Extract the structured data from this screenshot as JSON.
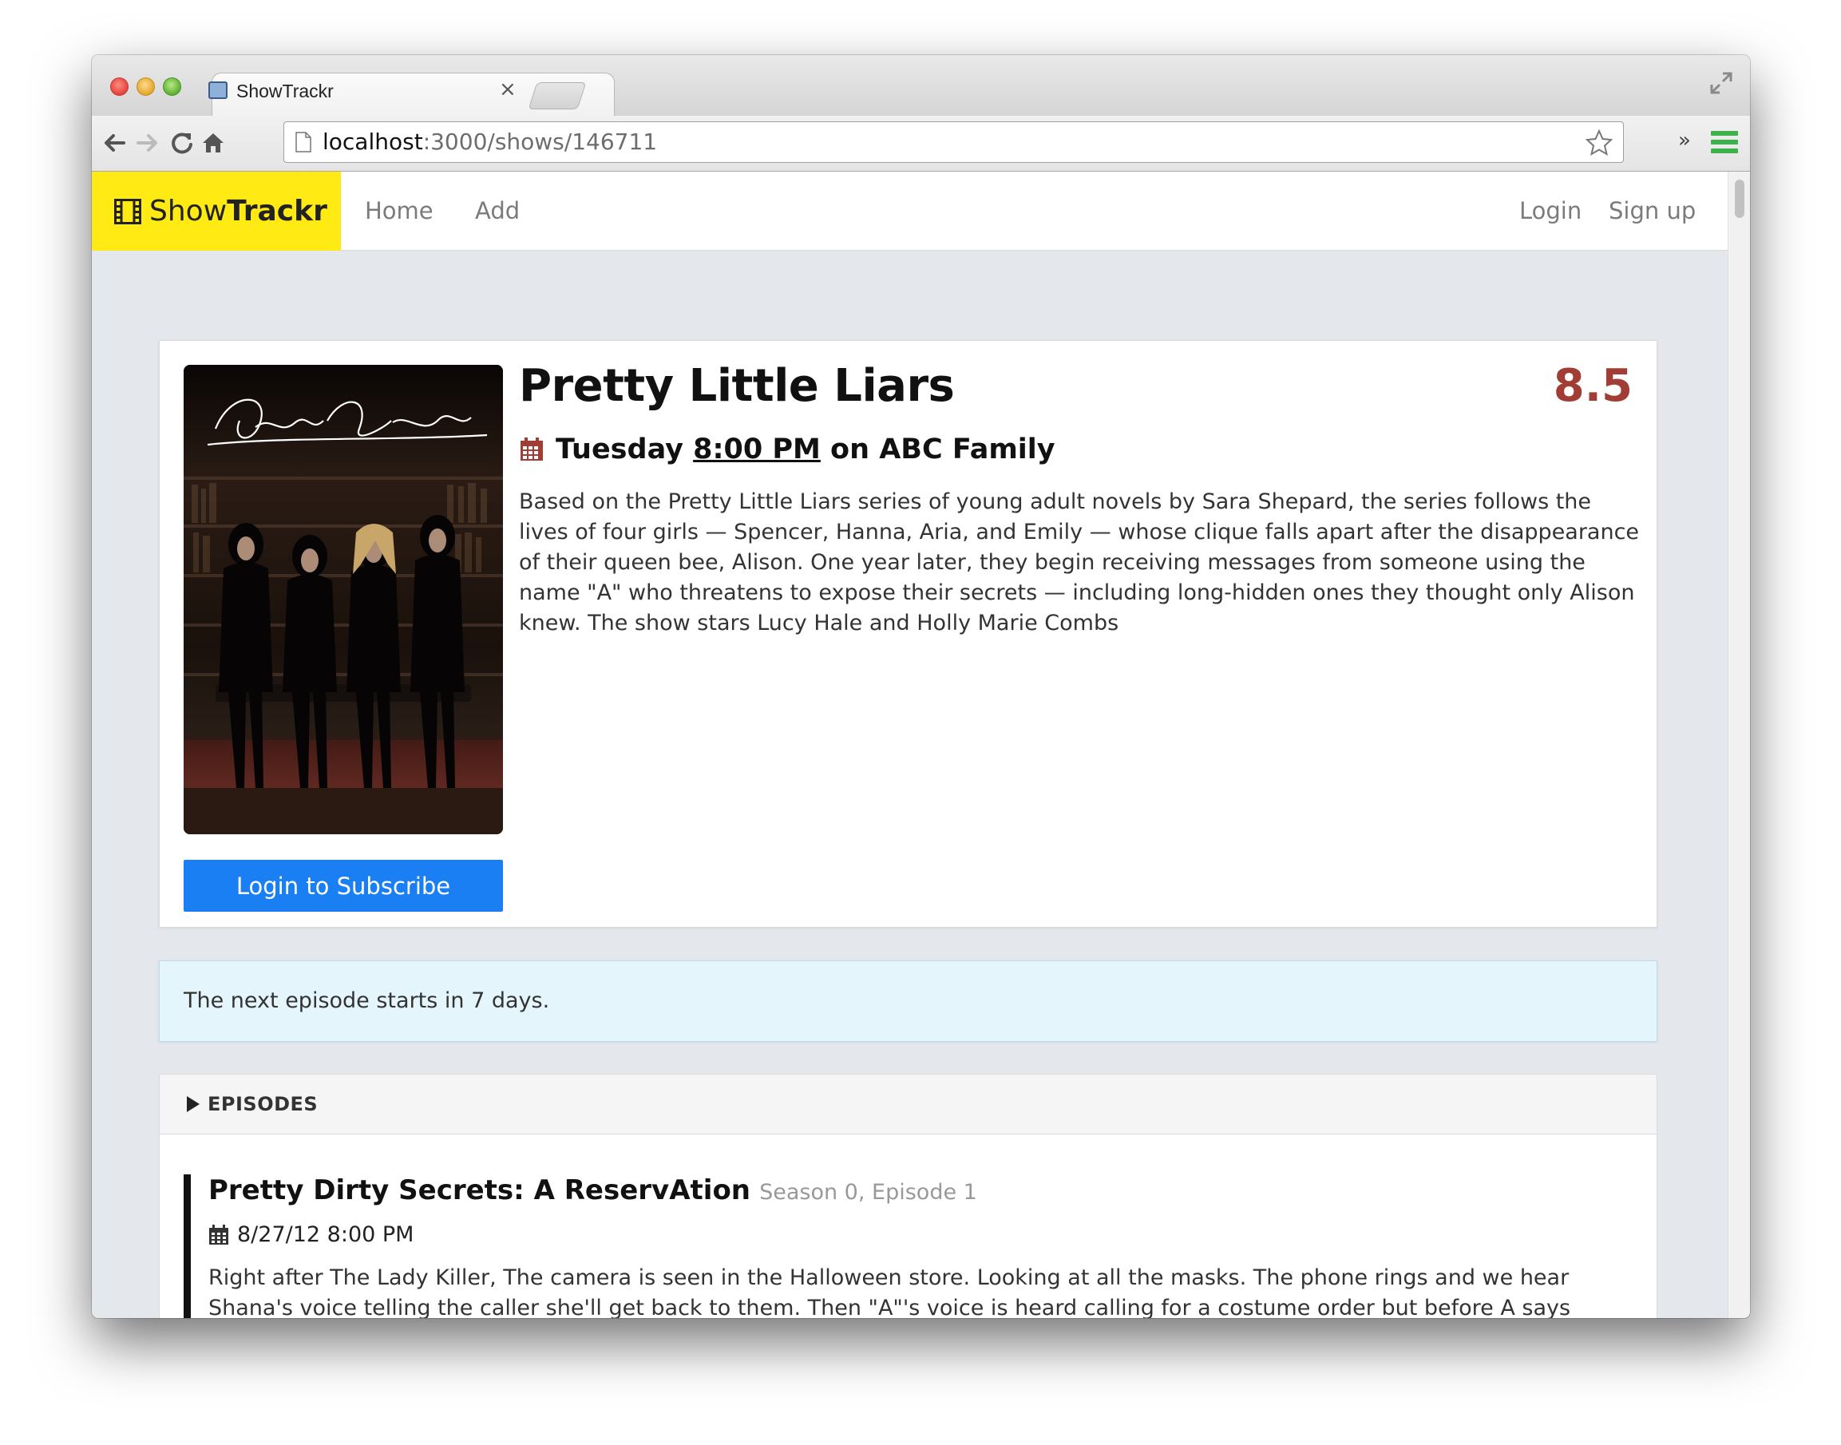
{
  "browser": {
    "tab_title": "ShowTrackr",
    "url_host": "localhost",
    "url_path": ":3000/shows/146711",
    "overflow_label": "»"
  },
  "navbar": {
    "brand_regular": "Show",
    "brand_bold": "Trackr",
    "links_left": [
      "Home",
      "Add"
    ],
    "links_right": [
      "Login",
      "Sign up"
    ]
  },
  "show": {
    "title": "Pretty Little Liars",
    "rating": "8.5",
    "air_day": "Tuesday",
    "air_time": "8:00 PM",
    "network_prefix": "on",
    "network": "ABC Family",
    "overview": "Based on the Pretty Little Liars series of young adult novels by Sara Shepard, the series follows the lives of four girls — Spencer, Hanna, Aria, and Emily — whose clique falls apart after the disappearance of their queen bee, Alison. One year later, they begin receiving messages from someone using the name \"A\" who threatens to expose their secrets — including long-hidden ones they thought only Alison knew. The show stars Lucy Hale and Holly Marie Combs",
    "poster_logo_text": "Pretty Little Liars",
    "subscribe_label": "Login to Subscribe"
  },
  "alert": {
    "text": "The next episode starts in 7 days."
  },
  "episodes": {
    "heading": "EPISODES",
    "items": [
      {
        "title": "Pretty Dirty Secrets: A ReservAtion",
        "meta": "Season 0, Episode 1",
        "date": "8/27/12 8:00 PM",
        "overview": "Right after The Lady Killer, The camera is seen in the Halloween store. Looking at all the masks. The phone rings and we hear Shana's voice telling the caller she'll get back to them. Then \"A\"'s voice is heard calling for a costume order but before A says who they are the call ends."
      }
    ]
  },
  "colors": {
    "brand_yellow": "#ffea14",
    "rating_red": "#a23d35",
    "button_blue": "#1a7ff3",
    "alert_bg": "#e4f5fb",
    "menu_green": "#3db24b"
  },
  "icons": {
    "brand": "film-icon",
    "airs": "calendar-icon",
    "episode_date": "calendar-icon",
    "panel_toggle": "triangle-right-icon"
  }
}
